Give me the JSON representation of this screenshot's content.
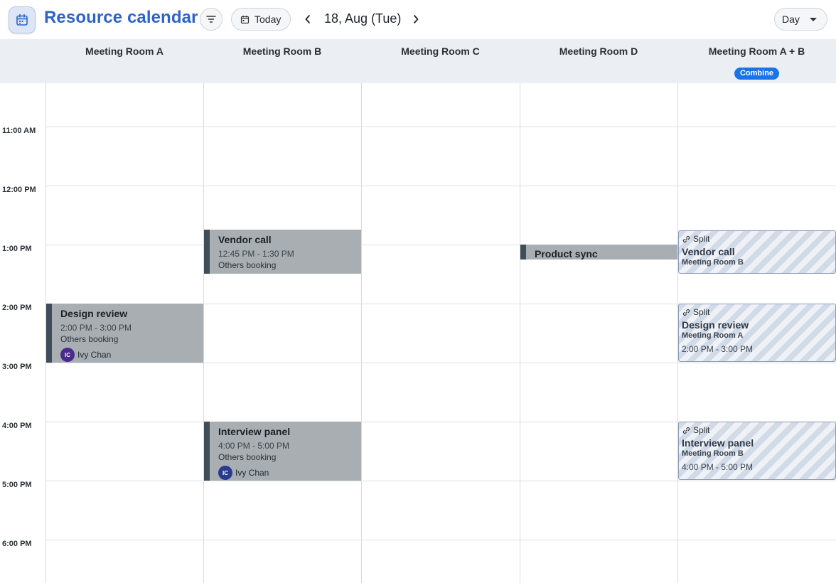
{
  "header": {
    "title": "Resource calendar",
    "today_label": "Today",
    "date_label": "18, Aug (Tue)",
    "view_label": "Day"
  },
  "resources": [
    {
      "name": "Meeting Room A"
    },
    {
      "name": "Meeting Room B"
    },
    {
      "name": "Meeting Room C"
    },
    {
      "name": "Meeting Room D"
    },
    {
      "name": "Meeting Room A + B",
      "badge": "Combine"
    }
  ],
  "time_labels": [
    "11:00 AM",
    "12:00 PM",
    "1:00 PM",
    "2:00 PM",
    "3:00 PM",
    "4:00 PM",
    "5:00 PM",
    "6:00 PM"
  ],
  "events": [
    {
      "title": "Vendor call",
      "time": "12:45 PM - 1:30 PM",
      "note": "Others booking"
    },
    {
      "title": "Product sync"
    },
    {
      "title": "Design review",
      "time": "2:00 PM - 3:00 PM",
      "note": "Others booking",
      "person": "Ivy Chan",
      "initials": "IC"
    },
    {
      "title": "Interview panel",
      "time": "4:00 PM - 5:00 PM",
      "note": "Others booking",
      "person": "Ivy Chan",
      "initials": "IC"
    }
  ],
  "split_events": [
    {
      "label": "Split",
      "title": "Vendor call",
      "room": "Meeting Room B"
    },
    {
      "label": "Split",
      "title": "Design review",
      "room": "Meeting Room A",
      "time": "2:00 PM - 3:00 PM"
    },
    {
      "label": "Split",
      "title": "Interview panel",
      "room": "Meeting Room B",
      "time": "4:00 PM - 5:00 PM"
    }
  ],
  "colors": {
    "accent": "#2e63c7",
    "badge": "#1a73e8",
    "event_fill": "#a8aeb2",
    "event_bar": "#3f4d58",
    "avatar_purple": "#4a2a8c",
    "avatar_navy": "#2a3b8f"
  },
  "icons": {
    "app": "calendar-icon",
    "filter": "filter-icon",
    "today": "calendar-small-icon",
    "prev": "chevron-left-icon",
    "next": "chevron-right-icon",
    "view": "caret-down-icon",
    "split": "link-icon"
  }
}
